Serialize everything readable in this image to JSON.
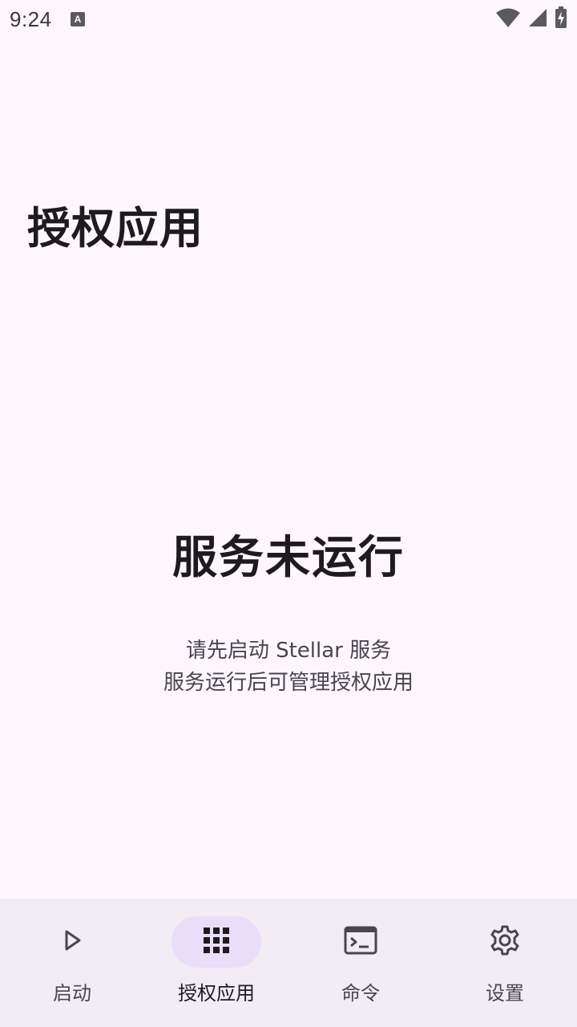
{
  "status_bar": {
    "time": "9:24",
    "icons": [
      "keyboard-a-icon",
      "wifi-icon",
      "cell-signal-icon",
      "battery-charging-icon"
    ]
  },
  "page": {
    "title": "授权应用"
  },
  "empty_state": {
    "title": "服务未运行",
    "line1": "请先启动 Stellar 服务",
    "line2": "服务运行后可管理授权应用"
  },
  "bottom_nav": {
    "items": [
      {
        "label": "启动",
        "icon": "play-icon",
        "active": false
      },
      {
        "label": "授权应用",
        "icon": "grid-icon",
        "active": true
      },
      {
        "label": "命令",
        "icon": "terminal-icon",
        "active": false
      },
      {
        "label": "设置",
        "icon": "gear-icon",
        "active": false
      }
    ]
  },
  "colors": {
    "background": "#fdf7fd",
    "nav_background": "#f2ecf4",
    "active_indicator": "#e8def8",
    "text_primary": "#1d1b20",
    "text_secondary": "#49454f"
  }
}
